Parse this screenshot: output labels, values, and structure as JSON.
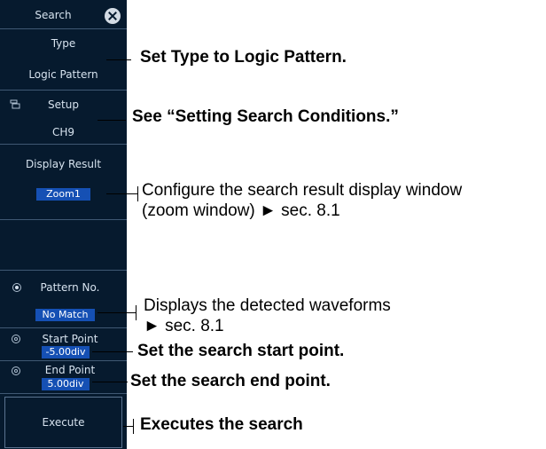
{
  "panel": {
    "title": "Search",
    "type_label": "Type",
    "type_value": "Logic Pattern",
    "setup_label": "Setup",
    "setup_value": "CH9",
    "display_result_label": "Display Result",
    "display_result_value": "Zoom1",
    "pattern_no_label": "Pattern No.",
    "pattern_no_value": "No Match",
    "start_point_label": "Start Point",
    "start_point_value": "-5.00div",
    "end_point_label": "End Point",
    "end_point_value": "5.00div",
    "execute_label": "Execute"
  },
  "callouts": {
    "type": "Set Type to Logic Pattern.",
    "setup": "See “Setting Search Conditions.”",
    "display_line1": "Configure the search result display window",
    "display_line2": "(zoom window) ► sec. 8.1",
    "pattern_line1": "Displays the detected waveforms",
    "pattern_line2": "► sec. 8.1",
    "start": "Set the search start point.",
    "end": "Set the search end point.",
    "execute": "Executes the search"
  },
  "colors": {
    "panel_background": "#061a2e",
    "highlight": "#1550b4"
  },
  "icons": [
    "close-icon",
    "setup-menu-icon",
    "radio-icon",
    "jog-knob-icon"
  ]
}
